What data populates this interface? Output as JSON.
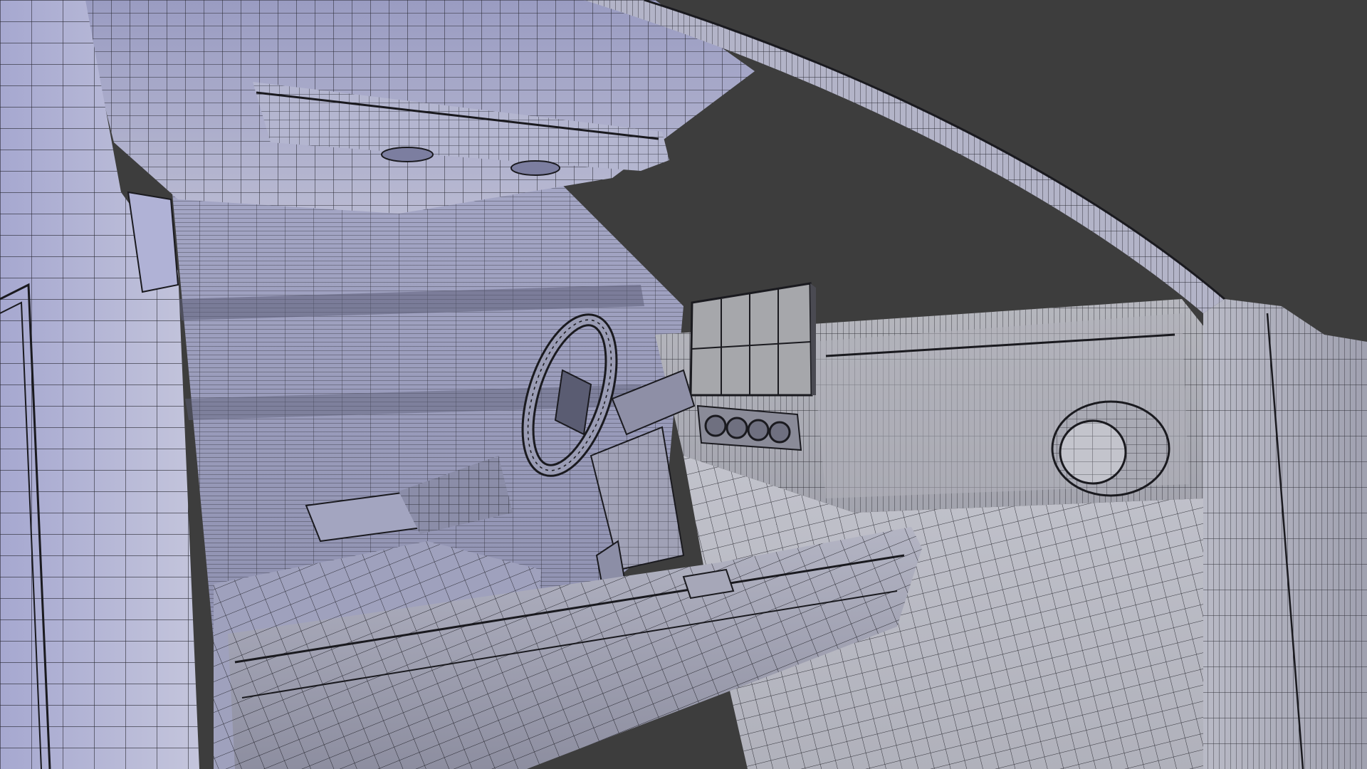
{
  "colors": {
    "background": "#3d3d3d",
    "surface_light": "#b8b9c4",
    "surface_lavender": "#a9abcf",
    "surface_mid": "#9b9cad",
    "surface_dark": "#6e6f7c",
    "wire": "#1a1a1f",
    "screen": "#a7a8ad"
  },
  "scene": {
    "view": "3d-viewport-wireframe",
    "subject": "car-interior-mesh"
  }
}
